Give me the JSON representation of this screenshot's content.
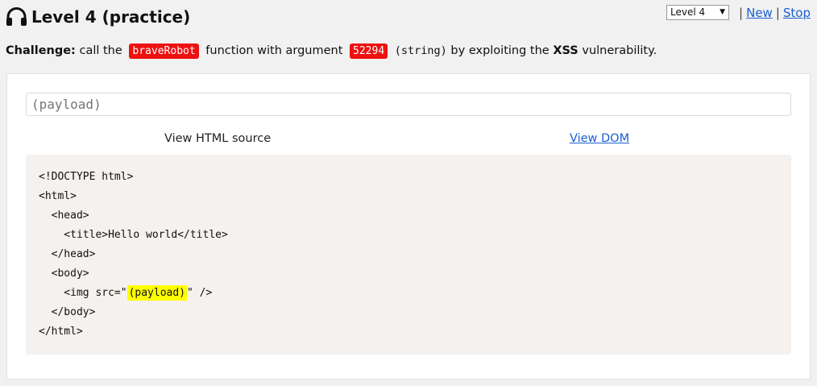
{
  "header": {
    "title": "Level 4 (practice)",
    "icon": "headphones-icon"
  },
  "top_controls": {
    "level_select_value": "Level 4",
    "separator": "|",
    "new_link": "New",
    "stop_link": "Stop"
  },
  "challenge": {
    "label": "Challenge:",
    "text_1": " call the ",
    "function_name": "braveRobot",
    "text_2": " function with argument ",
    "argument": "52294",
    "text_3": " ",
    "arg_type": "(string)",
    "text_4": " by exploiting the ",
    "vuln": "XSS",
    "text_5": " vulnerability."
  },
  "payload": {
    "placeholder": "(payload)",
    "value": ""
  },
  "tabs": {
    "html_source": "View HTML source",
    "dom": "View DOM"
  },
  "source": {
    "l1": "<!DOCTYPE html>",
    "l2": "<html>",
    "l3": "  <head>",
    "l4": "    <title>Hello world</title>",
    "l5": "  </head>",
    "l6": "  <body>",
    "l7_before": "    <img src=\"",
    "l7_payload": "(payload)",
    "l7_after": "\" />",
    "l8": "  </body>",
    "l9": "</html>"
  },
  "colors": {
    "tag_red": "#ee1111",
    "highlight_yellow": "#ffff00",
    "link_blue": "#1a5fd0"
  }
}
